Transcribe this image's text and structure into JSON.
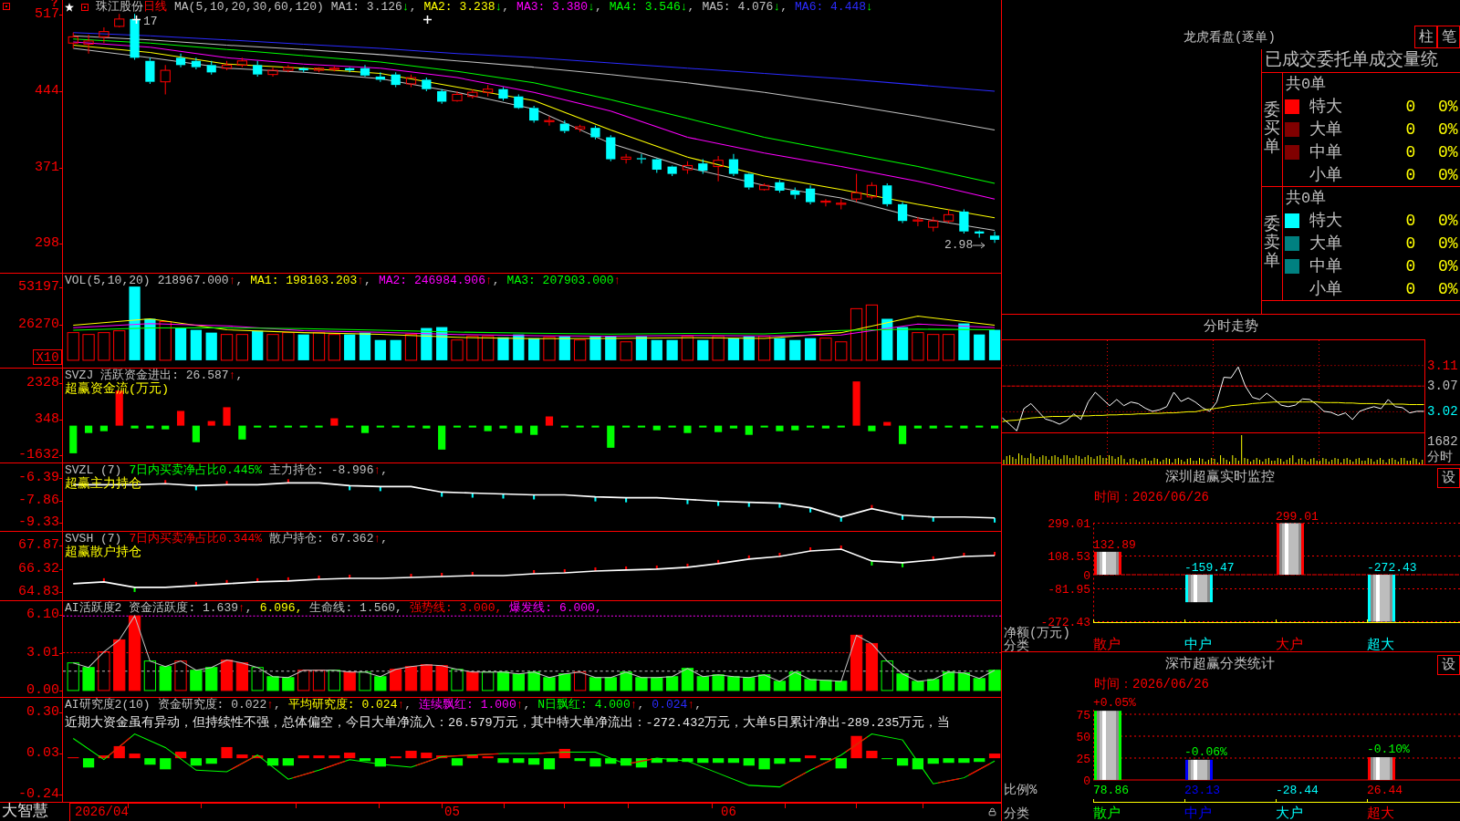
{
  "quote_chart": {
    "help_mark": "?",
    "stock_name": "珠江股份",
    "period": "日线",
    "ma_params": "MA(5,10,20,30,60,120)",
    "legend": [
      {
        "label": "MA1: 3.126",
        "arrow": "↓",
        "rising": false,
        "suffix": ",",
        "color": "#c0c0c0"
      },
      {
        "label": "MA2: 3.238",
        "arrow": "↓",
        "rising": false,
        "suffix": ",",
        "color": "#ffff00"
      },
      {
        "label": "MA3: 3.380",
        "arrow": "↓",
        "rising": false,
        "suffix": ",",
        "color": "#ff00ff"
      },
      {
        "label": "MA4: 3.546",
        "arrow": "↓",
        "rising": false,
        "suffix": ",",
        "color": "#00ff00"
      },
      {
        "label": "MA5: 4.076",
        "arrow": "↓",
        "rising": false,
        "suffix": ",",
        "color": "#c0c0c0"
      },
      {
        "label": "MA6: 4.448",
        "arrow": "↓",
        "rising": false,
        "color": "#2b2bff"
      }
    ],
    "high_marker": "17",
    "last_price": "2.98",
    "chart_data": {
      "type": "candlestick",
      "ohlc": [
        [
          490,
          500,
          485,
          496
        ],
        [
          489,
          498,
          480,
          492
        ],
        [
          496,
          505,
          490,
          501
        ],
        [
          506,
          518,
          505,
          513
        ],
        [
          513,
          518,
          474,
          476
        ],
        [
          473,
          476,
          451,
          453
        ],
        [
          453,
          469,
          441,
          464
        ],
        [
          476,
          480,
          467,
          469
        ],
        [
          473,
          476,
          465,
          467
        ],
        [
          469,
          473,
          460,
          462
        ],
        [
          466,
          473,
          464,
          469
        ],
        [
          469,
          476,
          467,
          473
        ],
        [
          469,
          473,
          458,
          460
        ],
        [
          460,
          467,
          458,
          464
        ],
        [
          464,
          469,
          462,
          467
        ],
        [
          466,
          467,
          462,
          464
        ],
        [
          464,
          467,
          462,
          466
        ],
        [
          465,
          468,
          463,
          466
        ],
        [
          466,
          467,
          462,
          464
        ],
        [
          466,
          469,
          458,
          459
        ],
        [
          458,
          462,
          453,
          455
        ],
        [
          460,
          462,
          448,
          450
        ],
        [
          451,
          460,
          448,
          457
        ],
        [
          455,
          457,
          444,
          446
        ],
        [
          444,
          446,
          432,
          434
        ],
        [
          435,
          444,
          434,
          441
        ],
        [
          439,
          446,
          437,
          443
        ],
        [
          443,
          450,
          439,
          446
        ],
        [
          446,
          448,
          435,
          437
        ],
        [
          439,
          441,
          427,
          428
        ],
        [
          428,
          430,
          414,
          416
        ],
        [
          415,
          420,
          411,
          416
        ],
        [
          413,
          416,
          404,
          406
        ],
        [
          408,
          412,
          405,
          410
        ],
        [
          409,
          411,
          398,
          400
        ],
        [
          400,
          402,
          377,
          379
        ],
        [
          379,
          384,
          375,
          381
        ],
        [
          380,
          384,
          375,
          379
        ],
        [
          379,
          380,
          366,
          369
        ],
        [
          372,
          373,
          363,
          365
        ],
        [
          369,
          377,
          365,
          373
        ],
        [
          375,
          379,
          365,
          368
        ],
        [
          372,
          382,
          358,
          378
        ],
        [
          379,
          384,
          363,
          365
        ],
        [
          365,
          366,
          350,
          352
        ],
        [
          350,
          356,
          349,
          354
        ],
        [
          357,
          359,
          347,
          349
        ],
        [
          349,
          352,
          341,
          345
        ],
        [
          351,
          354,
          336,
          338
        ],
        [
          338,
          341,
          334,
          339
        ],
        [
          336,
          341,
          331,
          337
        ],
        [
          341,
          365,
          338,
          347
        ],
        [
          343,
          357,
          341,
          354
        ],
        [
          354,
          356,
          334,
          336
        ],
        [
          336,
          338,
          318,
          320
        ],
        [
          320,
          324,
          315,
          321
        ],
        [
          314,
          324,
          310,
          320
        ],
        [
          320,
          331,
          318,
          326
        ],
        [
          329,
          331,
          308,
          310
        ],
        [
          310,
          311,
          304,
          308
        ],
        [
          306,
          310,
          299,
          302
        ]
      ],
      "ylim": [
        270.5,
        531.2
      ],
      "yticks": [
        517,
        444,
        371,
        298
      ]
    }
  },
  "volume_chart": {
    "title": "VOL(5,10,20)",
    "legend": [
      {
        "label": "218967.000",
        "arrow": "↑",
        "rising": true,
        "suffix": ",",
        "color": "#c0c0c0"
      },
      {
        "label": "MA1: 198103.203",
        "arrow": "↑",
        "rising": true,
        "suffix": ",",
        "color": "#ffff00"
      },
      {
        "label": "MA2: 246984.906",
        "arrow": "↑",
        "rising": true,
        "suffix": ",",
        "color": "#ff00ff"
      },
      {
        "label": "MA3: 207903.000",
        "arrow": "↑",
        "rising": true,
        "color": "#00ff00"
      }
    ],
    "unit": "X10",
    "chart_data": {
      "type": "line",
      "series": [
        {
          "color": "#ffff00",
          "values": [
            25600,
            30300,
            22200,
            20200,
            18900,
            16800,
            15800,
            16000,
            16500,
            16000,
            20200,
            32300,
            25600
          ]
        },
        {
          "color": "#ff00ff",
          "values": [
            23800,
            26900,
            25200,
            21700,
            20400,
            18800,
            18000,
            17600,
            18100,
            17700,
            18500,
            26500,
            24000
          ]
        },
        {
          "color": "#00ff00",
          "values": [
            22000,
            23600,
            23700,
            23200,
            21900,
            20600,
            19800,
            19200,
            19700,
            19300,
            21800,
            22800,
            22300
          ]
        }
      ],
      "ylim": [
        -5370,
        63296
      ],
      "yticks": [
        53197,
        26270
      ]
    }
  },
  "indicators": [
    {
      "kind": "flow_bars",
      "name": "SVZJ",
      "legend": [
        {
          "label": "活跃资金进出: 26.587",
          "arrow": "↑",
          "rising": true,
          "suffix": ",",
          "color": "#c0c0c0"
        }
      ],
      "subtitle": "超赢资金流(万元)",
      "y_ticks": [
        "2328",
        "348",
        "-1632"
      ]
    },
    {
      "kind": "holding_line",
      "name": "SVZL (7)",
      "legend": [
        {
          "label": "7日内买卖净占比0.445%",
          "color": "#00ff00"
        },
        {
          "label": "主力持仓: -8.996",
          "arrow": "↑",
          "rising": true,
          "suffix": ",",
          "color": "#c0c0c0"
        }
      ],
      "subtitle": "超赢主力持仓",
      "chart_data": {
        "type": "line",
        "series": [
          {
            "color": "#ffffff",
            "values": [
              -6.82,
              -6.82,
              -6.82,
              -6.76,
              -6.88,
              -6.82,
              -6.82,
              -6.7,
              -6.7,
              -6.88,
              -6.94,
              -6.94,
              -7.31,
              -7.37,
              -7.43,
              -7.49,
              -7.49,
              -7.62,
              -7.68,
              -7.68,
              -7.8,
              -7.92,
              -7.98,
              -8.04,
              -8.35,
              -8.96,
              -8.41,
              -8.84,
              -8.96,
              -8.96,
              -9.02
            ]
          }
        ],
        "ylim": [
          -9.88,
          -5.41
        ],
        "yticks": [
          -6.39,
          -7.86,
          -9.33
        ]
      }
    },
    {
      "kind": "holding_line",
      "name": "SVSH (7)",
      "legend": [
        {
          "label": "7日内买卖净占比0.344%",
          "color": "#ff0000"
        },
        {
          "label": "散户持仓: 67.362",
          "arrow": "↑",
          "rising": true,
          "suffix": ",",
          "color": "#c0c0c0"
        }
      ],
      "subtitle": "超赢散户持仓",
      "chart_data": {
        "type": "line",
        "series": [
          {
            "color": "#ffffff",
            "values": [
              65.37,
              65.49,
              65.13,
              65.13,
              65.25,
              65.37,
              65.49,
              65.55,
              65.66,
              65.72,
              65.72,
              65.78,
              65.84,
              65.9,
              65.9,
              66.02,
              66.08,
              66.2,
              66.26,
              66.32,
              66.44,
              66.68,
              66.98,
              67.15,
              67.51,
              67.63,
              66.86,
              66.74,
              66.92,
              67.15,
              67.21
            ]
          }
        ],
        "ylim": [
          64.29,
          68.76
        ],
        "yticks": [
          67.87,
          66.32,
          64.83
        ]
      }
    },
    {
      "kind": "activity_bars",
      "name": "AI活跃度2",
      "legend": [
        {
          "label": "资金活跃度: 1.639",
          "arrow": "↑",
          "rising": true,
          "suffix": ",",
          "color": "#c0c0c0"
        },
        {
          "label": "6.096,",
          "color": "#ffff00"
        },
        {
          "label": "生命线: 1.560,",
          "color": "#c0c0c0"
        },
        {
          "label": "强势线: 3.000,",
          "color": "#ff0000"
        },
        {
          "label": "爆发线: 6.000,",
          "color": "#ff00ff"
        }
      ],
      "chart_data": {
        "type": "line",
        "series": [
          {
            "color": "#c0c0c0",
            "values": [
              2.23,
              1.86,
              3.12,
              4.09,
              6.03,
              2.38,
              1.93,
              2.38,
              1.64,
              1.86,
              2.46,
              2.23,
              1.86,
              1.12,
              1.04,
              1.64,
              1.64,
              1.64,
              1.49,
              1.49,
              1.12,
              1.71,
              1.93,
              2.08,
              2.01,
              1.71,
              1.49,
              1.49,
              1.49,
              1.34,
              1.49,
              1.04,
              1.34,
              1.49,
              1.04,
              1.04,
              1.49,
              1.04,
              1.04,
              1.12,
              1.79,
              1.12,
              1.26,
              1.12,
              1.04,
              1.26,
              0.74,
              1.49,
              0.89,
              0.82,
              0.74,
              4.46,
              3.79,
              2.38,
              1.34,
              0.74,
              0.89,
              1.49,
              1.41,
              0.97,
              1.64
            ]
          }
        ],
        "ylim": [
          -0.52,
          7.22
        ],
        "yticks": [
          {
            "value": 6.1,
            "label": "6.10"
          },
          {
            "value": 3.01,
            "label": "3.01"
          },
          {
            "value": 0,
            "label": "0.00"
          }
        ]
      }
    },
    {
      "kind": "research_bars",
      "name": "AI研究度2(10)",
      "legend": [
        {
          "label": "资金研究度: 0.022",
          "arrow": "↑",
          "rising": true,
          "suffix": ",",
          "color": "#c0c0c0"
        },
        {
          "label": "平均研究度: 0.024",
          "arrow": "↑",
          "rising": true,
          "suffix": ",",
          "color": "#ffff00"
        },
        {
          "label": "连续飘红: 1.000",
          "arrow": "↑",
          "rising": true,
          "suffix": ",",
          "color": "#ff00ff"
        },
        {
          "label": "N日飘红: 4.000",
          "arrow": "↑",
          "rising": true,
          "suffix": ",",
          "color": "#00ff00"
        },
        {
          "label": "0.024",
          "arrow": "↑",
          "rising": true,
          "suffix": ",",
          "color": "#2b2bff"
        }
      ],
      "comment": "近期大资金虽有异动，但持续性不强，总体偏空，今日大单净流入：26.579万元，其中特大单净流出：-272.432万元，大单5日累计净出-289.235万元，当",
      "chart_data": {
        "type": "line",
        "series": [
          {
            "color": "#00ff00",
            "values": [
              0.13,
              -0.01,
              0.16,
              0.07,
              -0.08,
              -0.09,
              0.02,
              -0.14,
              -0.08,
              -0.01,
              -0.04,
              -0.06,
              0.01,
              0.02,
              0.03,
              0.03,
              0.04,
              0.04,
              -0.04,
              0,
              -0.02,
              -0.1,
              -0.18,
              -0.19,
              -0.08,
              0.02,
              0.16,
              0.12,
              -0.17,
              -0.13,
              -0.02
            ]
          }
        ],
        "ylim": [
          -0.289,
          0.398
        ],
        "yticks": [
          {
            "value": 0.3,
            "label": "0.30"
          },
          {
            "value": 0.03,
            "label": "0.03"
          },
          {
            "value": -0.24,
            "label": "-0.24"
          }
        ]
      }
    }
  ],
  "time_axis": {
    "brand": "大智慧",
    "dates": [
      "2026/04",
      "05",
      "06"
    ]
  },
  "dragon_tiger": {
    "title": "龙虎看盘(逐单)",
    "view_buttons": [
      "柱",
      "笔"
    ],
    "table_title": "已成交委托单成交量统",
    "groups": [
      {
        "side": "委买单",
        "total": "共0单",
        "rows": [
          {
            "label": "特大",
            "count": "0",
            "share": "0%",
            "color": "#ff0000"
          },
          {
            "label": "大单",
            "count": "0",
            "share": "0%",
            "color": "#800000"
          },
          {
            "label": "中单",
            "count": "0",
            "share": "0%",
            "color": "#800000"
          },
          {
            "label": "小单",
            "count": "0",
            "share": "0%"
          }
        ]
      },
      {
        "side": "委卖单",
        "total": "共0单",
        "rows": [
          {
            "label": "特大",
            "count": "0",
            "share": "0%",
            "color": "#00ffff"
          },
          {
            "label": "大单",
            "count": "0",
            "share": "0%",
            "color": "#008080"
          },
          {
            "label": "中单",
            "count": "0",
            "share": "0%",
            "color": "#008080"
          },
          {
            "label": "小单",
            "count": "0",
            "share": "0%"
          }
        ]
      }
    ]
  },
  "intraday": {
    "title": "分时走势",
    "tick_styles": [
      {
        "color": "#ff0000"
      },
      {
        "color": "#c0c0c0"
      },
      {
        "color": "#00ffff"
      }
    ],
    "volume_tick": "1682",
    "unit": "分时",
    "chart_data": {
      "type": "line",
      "series": [
        {
          "color": "#ffffff",
          "values": [
            3.008,
            2.996,
            2.983,
            3.026,
            3.036,
            3.021,
            3.006,
            3.002,
            2.996,
            3.003,
            3.016,
            3.005,
            3.039,
            3.058,
            3.045,
            3.032,
            3.044,
            3.032,
            3.039,
            3.036,
            3.027,
            3.021,
            3.024,
            3.03,
            3.058,
            3.04,
            3.047,
            3.039,
            3.028,
            3.021,
            3.039,
            3.087,
            3.086,
            3.107,
            3.07,
            3.048,
            3.044,
            3.056,
            3.045,
            3.033,
            3.03,
            3.033,
            3.045,
            3.044,
            3.034,
            3.021,
            3.019,
            3.013,
            3.018,
            3.005,
            3.021,
            3.026,
            3.03,
            3.026,
            3.044,
            3.03,
            3.028,
            3.018,
            3.021,
            3.021
          ]
        },
        {
          "color": "#ffff00",
          "values": [
            3.001,
            3.003,
            3.004,
            3.006,
            3.008,
            3.009,
            3.01,
            3.011,
            3.011,
            3.011,
            3.012,
            3.012,
            3.012,
            3.013,
            3.013,
            3.014,
            3.014,
            3.015,
            3.015,
            3.016,
            3.016,
            3.017,
            3.017,
            3.018,
            3.018,
            3.019,
            3.02,
            3.02,
            3.023,
            3.025,
            3.027,
            3.029,
            3.032,
            3.033,
            3.034,
            3.036,
            3.037,
            3.038,
            3.039,
            3.039,
            3.039,
            3.039,
            3.039,
            3.039,
            3.039,
            3.038,
            3.038,
            3.038,
            3.037,
            3.037,
            3.036,
            3.036,
            3.036,
            3.035,
            3.035,
            3.035,
            3.035,
            3.034,
            3.034,
            3.034
          ]
        }
      ],
      "ylim": [
        2.98,
        3.159
      ],
      "yticks": [
        3.11,
        3.07,
        3.02
      ],
      "grid": true
    }
  },
  "realtime_monitor": {
    "title": "深圳超赢实时监控",
    "settings_button": "设",
    "time": "时间：2026/06/26",
    "chart_data": {
      "type": "bar",
      "categories": [
        "散户",
        "中户",
        "大户",
        "超大"
      ],
      "values": [
        132.89,
        -159.47,
        299.01,
        -272.43
      ],
      "ylim": [
        -272.43,
        299.01
      ],
      "yticks": [
        {
          "value": 299.01,
          "label": "299.01"
        },
        {
          "value": 108.53,
          "label": "108.53"
        },
        {
          "value": 0,
          "label": "0"
        },
        {
          "value": -81.95,
          "label": "-81.95"
        },
        {
          "value": -272.43,
          "label": "-272.43"
        }
      ],
      "grid": true,
      "ylabel": "净额(万元)",
      "xlabel": "分类",
      "data_labels": true
    }
  },
  "category_stats": {
    "title": "深市超赢分类统计",
    "settings_button": "设",
    "time": "时间：2026/06/26",
    "annotation_states": [
      {
        "rising": true
      },
      {
        "rising": false
      },
      {
        "rising": false
      }
    ],
    "chart_data": {
      "type": "bar",
      "categories": [
        "散户",
        "中户",
        "大户",
        "超大"
      ],
      "series": [
        {
          "color": "#00ff00",
          "values": [
            79,
            null,
            null,
            null
          ]
        },
        {
          "color": "#0000ff",
          "values": [
            null,
            23,
            null,
            null
          ]
        },
        {
          "color": "#00ffff",
          "values": [
            null,
            null,
            null,
            null
          ]
        },
        {
          "color": "#ff0000",
          "values": [
            null,
            null,
            null,
            26
          ]
        }
      ],
      "stacked": true,
      "ylim": [
        0,
        80
      ],
      "yticks": [
        {
          "value": 75,
          "label": "75"
        },
        {
          "value": 50,
          "label": "50"
        },
        {
          "value": 25,
          "label": "25"
        },
        {
          "value": 0,
          "label": "0"
        }
      ],
      "grid": true,
      "ylabel": "比例%",
      "xlabel": "分类",
      "value_labels": [
        "78.86",
        "23.13",
        "-28.44",
        "26.44"
      ],
      "annotations": [
        {
          "x": "散户",
          "y": 79,
          "text": "+0.05%"
        },
        {
          "x": "中户",
          "y": 23,
          "text": "-0.06%"
        },
        {
          "x": "超大",
          "y": 26,
          "text": "-0.10%"
        }
      ]
    }
  }
}
